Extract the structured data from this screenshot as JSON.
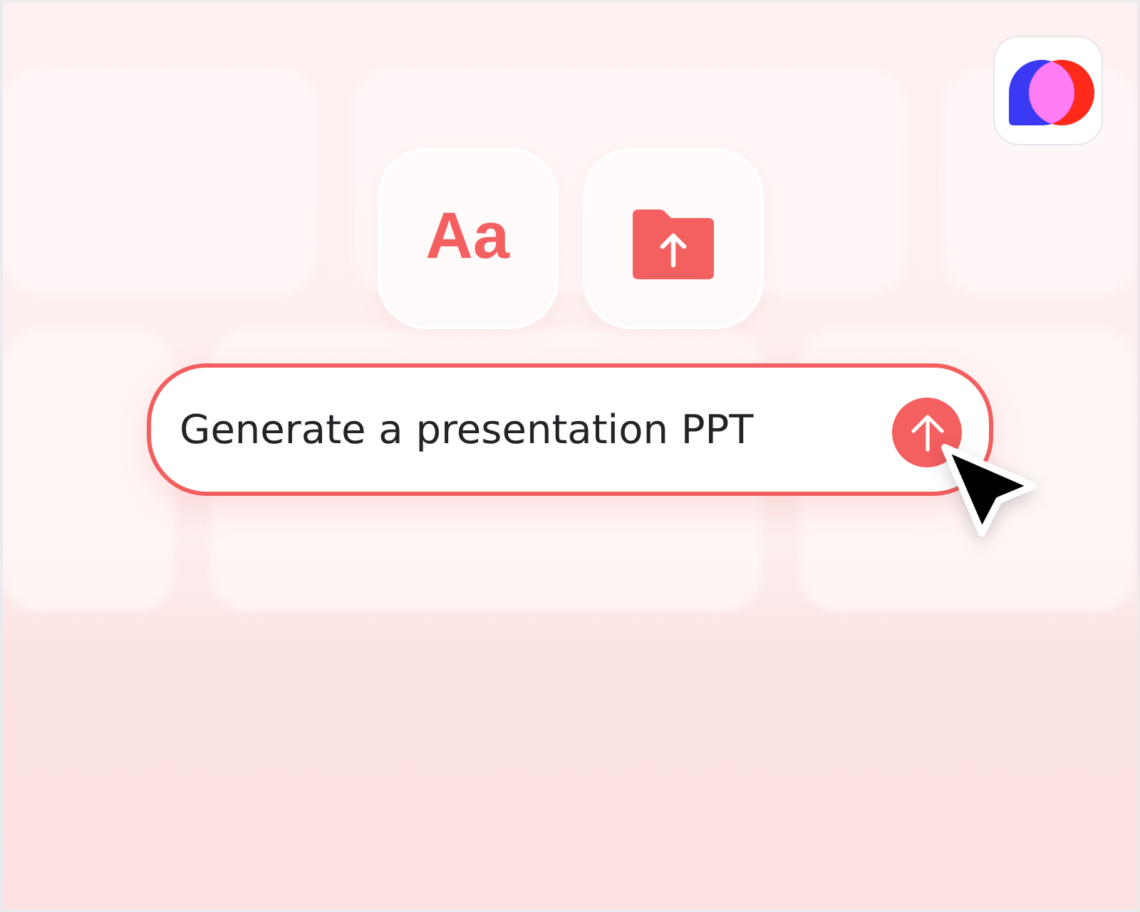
{
  "tools": [
    {
      "kind": "text",
      "label": "Aa"
    },
    {
      "kind": "upload"
    }
  ],
  "prompt": {
    "value": "Generate a presentation PPT",
    "focused": true
  }
}
